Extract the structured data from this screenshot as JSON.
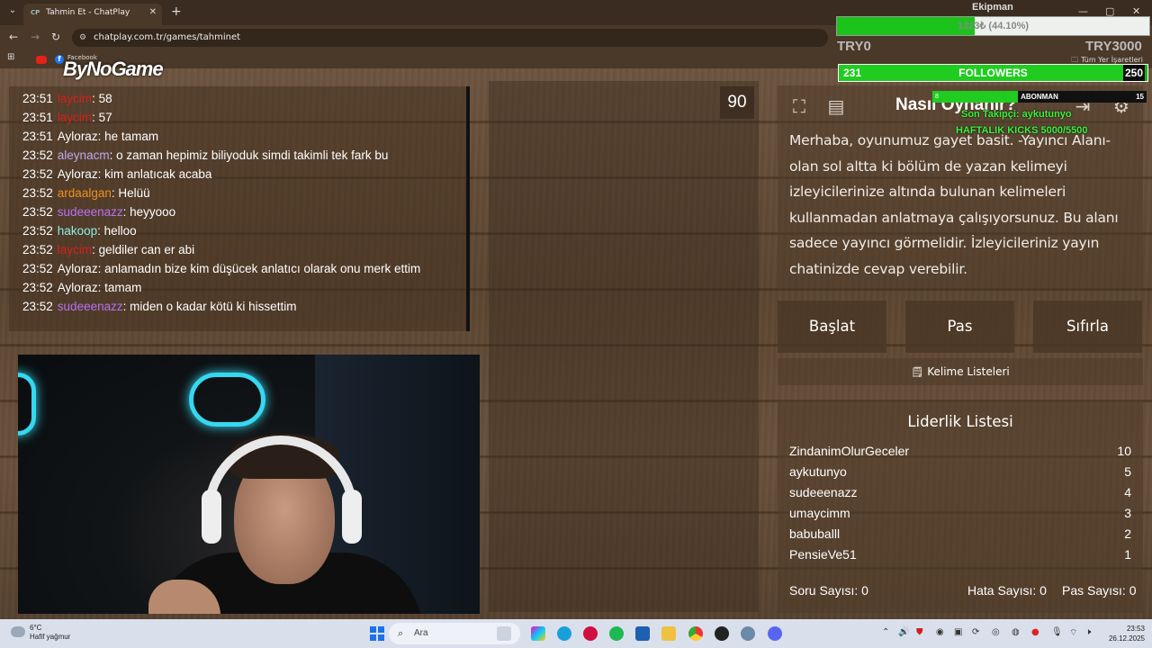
{
  "browser": {
    "tab_title": "Tahmin Et - ChatPlay",
    "tab_favicon": "CP",
    "url": "chatplay.com.tr/games/tahminet",
    "bookmark_facebook_label": "Facebook",
    "all_bookmarks_label": "Tüm Yer İşaretleri"
  },
  "logo": "ByNoGame",
  "chat": [
    {
      "time": "23:51",
      "user": "laycim",
      "color": "#d4201c",
      "text": ": 58"
    },
    {
      "time": "23:51",
      "user": "laycim",
      "color": "#d4201c",
      "text": ": 57"
    },
    {
      "time": "23:51",
      "user": "Ayloraz",
      "color": "#ffffff",
      "text": ": he tamam"
    },
    {
      "time": "23:52",
      "user": "aleynacm",
      "color": "#c0a8f0",
      "text": ": o zaman hepimiz biliyoduk simdi takimli tek fark bu"
    },
    {
      "time": "23:52",
      "user": "Ayloraz",
      "color": "#ffffff",
      "text": ": kim anlatıcak acaba"
    },
    {
      "time": "23:52",
      "user": "ardaalgan",
      "color": "#f0901c",
      "text": ": Helüü"
    },
    {
      "time": "23:52",
      "user": "sudeeenazz",
      "color": "#b870f0",
      "text": ": heyyooo"
    },
    {
      "time": "23:52",
      "user": "hakoop",
      "color": "#8ff0e8",
      "text": ": helloo"
    },
    {
      "time": "23:52",
      "user": "laycim",
      "color": "#d4201c",
      "text": ": geldiler can er abi"
    },
    {
      "time": "23:52",
      "user": "Ayloraz",
      "color": "#ffffff",
      "text": ": anlamadın bize kim düşücek anlatıcı olarak onu merk ettim"
    },
    {
      "time": "23:52",
      "user": "Ayloraz",
      "color": "#ffffff",
      "text": ": tamam"
    },
    {
      "time": "23:52",
      "user": "sudeeenazz",
      "color": "#b870f0",
      "text": ": miden o kadar kötü ki hissettim"
    }
  ],
  "timer": "90",
  "howto": {
    "title": "Nasıl Oynanır?",
    "text": "Merhaba, oyunumuz gayet basit. -Yayıncı Alanı- olan sol altta ki bölüm de yazan kelimeyi izleyicilerinize altında bulunan kelimeleri kullanmadan anlatmaya çalışıyorsunuz. Bu alanı sadece yayıncı görmelidir. İzleyicileriniz yayın chatinizde cevap verebilir."
  },
  "controls": {
    "start": "Başlat",
    "pass": "Pas",
    "reset": "Sıfırla"
  },
  "word_lists_label": "Kelime Listeleri",
  "leaderboard": {
    "title": "Liderlik Listesi",
    "rows": [
      {
        "name": "ZindanimOlurGeceler",
        "score": "10"
      },
      {
        "name": "aykutunyo",
        "score": "5"
      },
      {
        "name": "sudeeenazz",
        "score": "4"
      },
      {
        "name": "umaycimm",
        "score": "3"
      },
      {
        "name": "babuballl",
        "score": "2"
      },
      {
        "name": "PensieVe51",
        "score": "1"
      }
    ]
  },
  "stats": {
    "questions": "Soru Sayısı: 0",
    "errors": "Hata Sayısı: 0",
    "passes": "Pas Sayısı: 0"
  },
  "overlay": {
    "goal_label": "Ekipman",
    "goal_text": "1323₺ (44.10%)",
    "goal_progress": 0.441,
    "goal_min": "TRY0",
    "goal_max": "TRY3000",
    "followers_current": "231",
    "followers_label": "FOLLOWERS",
    "followers_target": "250",
    "followers_progress": 0.924,
    "sub_current": "8",
    "sub_label": "ABONMAN",
    "sub_target": "15",
    "sub_progress": 0.4,
    "last_follower": "Son Takipçi: aykutunyo",
    "kicks": "HAFTALIK KICKS 5000/5500"
  },
  "taskbar": {
    "weather_temp": "6°C",
    "weather_desc": "Hafif yağmur",
    "search_placeholder": "Ara",
    "time": "23:53",
    "date": "26.12.2025"
  },
  "colors": {
    "wood": "#5c4632",
    "accent_green": "#20cc20",
    "neon": "#35d8f0"
  }
}
